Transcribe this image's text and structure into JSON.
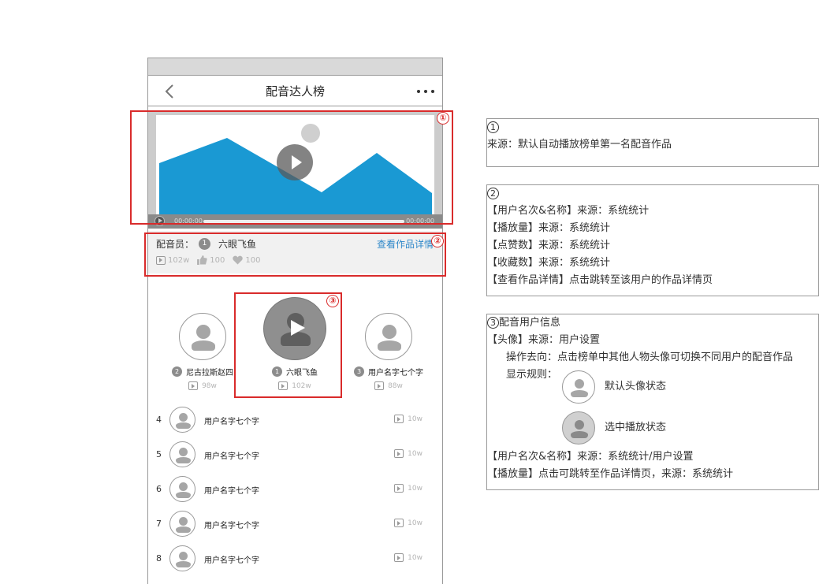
{
  "header": {
    "title": "配音达人榜"
  },
  "video": {
    "current_time": "00:00:00",
    "total_time": "00:00:00"
  },
  "dubber": {
    "label": "配音员：",
    "rank": "1",
    "name": "六眼飞鱼",
    "detail_link": "查看作品详情",
    "plays": "102w",
    "likes": "100",
    "favorites": "100"
  },
  "podium": [
    {
      "rank": "2",
      "name": "尼古拉斯赵四",
      "plays": "98w"
    },
    {
      "rank": "1",
      "name": "六眼飞鱼",
      "plays": "102w"
    },
    {
      "rank": "3",
      "name": "用户名字七个字",
      "plays": "88w"
    }
  ],
  "list": [
    {
      "rank": "4",
      "name": "用户名字七个字",
      "plays": "10w"
    },
    {
      "rank": "5",
      "name": "用户名字七个字",
      "plays": "10w"
    },
    {
      "rank": "6",
      "name": "用户名字七个字",
      "plays": "10w"
    },
    {
      "rank": "7",
      "name": "用户名字七个字",
      "plays": "10w"
    },
    {
      "rank": "8",
      "name": "用户名字七个字",
      "plays": "10w"
    }
  ],
  "annotations": {
    "n1": "①",
    "n2": "②",
    "n3": "③"
  },
  "notes": {
    "note1": {
      "num": "1",
      "line1": "来源：默认自动播放榜单第一名配音作品"
    },
    "note2": {
      "num": "2",
      "lines": [
        "【用户名次&名称】来源：系统统计",
        "【播放量】来源：系统统计",
        "【点赞数】来源：系统统计",
        "【收藏数】来源：系统统计",
        "【查看作品详情】点击跳转至该用户的作品详情页"
      ]
    },
    "note3": {
      "num": "3",
      "title": "配音用户信息",
      "avatar_line": "【头像】来源：用户设置",
      "action_line": "操作去向：点击榜单中其他人物头像可切换不同用户的配音作品",
      "display_rule": "显示规则：",
      "default_state": "默认头像状态",
      "selected_state": "选中播放状态",
      "rank_line": "【用户名次&名称】来源：系统统计/用户设置",
      "plays_line": "【播放量】点击可跳转至作品详情页，来源：系统统计"
    }
  },
  "colors": {
    "mountain": "#1a99d3",
    "annotation_red": "#d92b2b",
    "link_blue": "#2f88c9"
  }
}
